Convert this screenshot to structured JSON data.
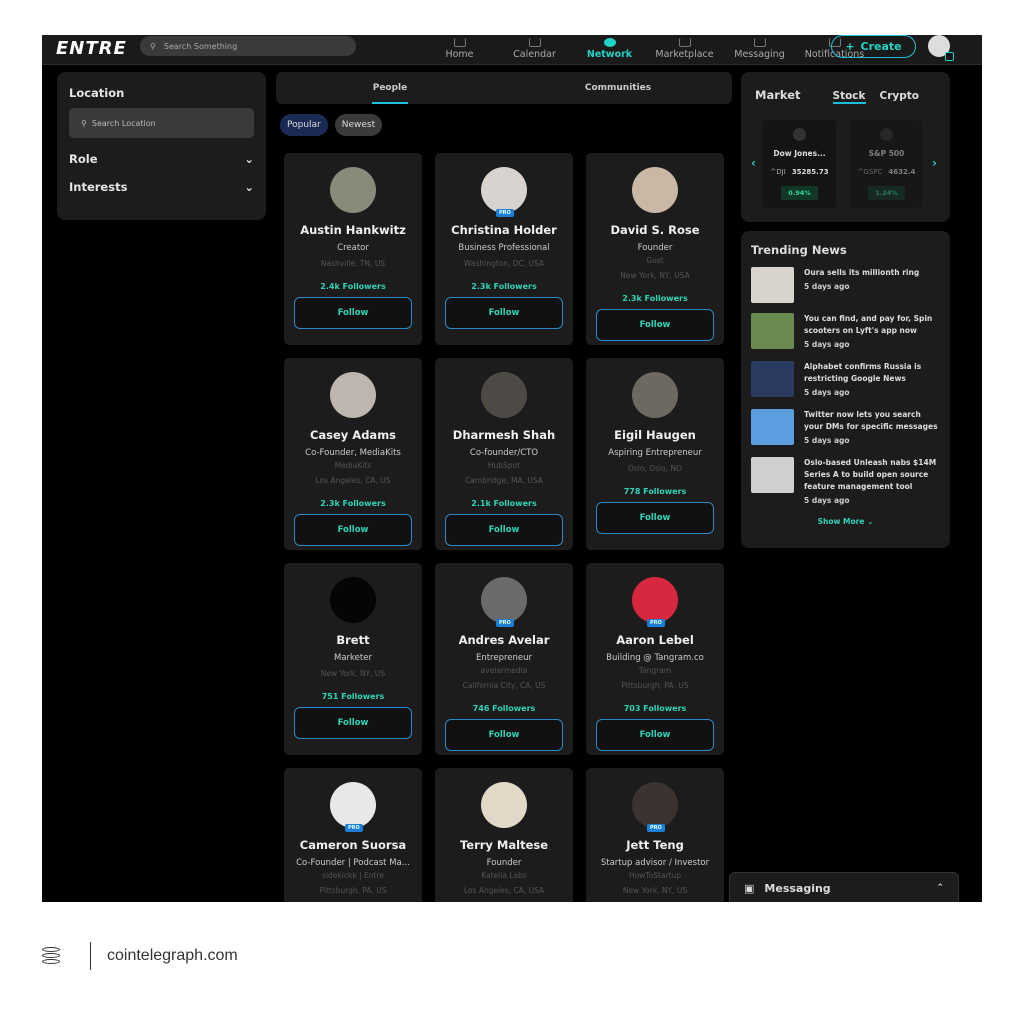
{
  "header": {
    "logo": "ENTRE",
    "search_placeholder": "Search Something",
    "nav": [
      {
        "label": "Home",
        "icon": "home-icon"
      },
      {
        "label": "Calendar",
        "icon": "calendar-icon"
      },
      {
        "label": "Network",
        "icon": "network-icon",
        "active": true
      },
      {
        "label": "Marketplace",
        "icon": "store-icon"
      },
      {
        "label": "Messaging",
        "icon": "mail-icon"
      },
      {
        "label": "Notifications",
        "icon": "bell-icon"
      }
    ],
    "create_label": "Create"
  },
  "filters": {
    "location_title": "Location",
    "location_placeholder": "Search Location",
    "role": "Role",
    "interests": "Interests"
  },
  "tabs": [
    {
      "label": "People",
      "active": true
    },
    {
      "label": "Communities"
    }
  ],
  "pills": [
    "Popular",
    "Newest"
  ],
  "people": [
    {
      "name": "Austin Hankwitz",
      "title": "Creator",
      "location": "Nashville, TN, US",
      "followers": "2.4k Followers",
      "color": "#8a8a7a"
    },
    {
      "name": "Christina Holder",
      "title": "Business Professional",
      "location": "Washington, DC, USA",
      "followers": "2.3k Followers",
      "pro": true,
      "color": "#d9d3cf"
    },
    {
      "name": "David S. Rose",
      "title": "Founder",
      "company": "Gust",
      "location": "New York, NY, USA",
      "followers": "2.3k Followers",
      "color": "#c9b8a5"
    },
    {
      "name": "Casey Adams",
      "title": "Co-Founder, MediaKits",
      "company": "MediaKits",
      "location": "Los Angeles, CA, US",
      "followers": "2.3k Followers",
      "color": "#bdb6ae"
    },
    {
      "name": "Dharmesh Shah",
      "title": "Co-founder/CTO",
      "company": "HubSpot",
      "location": "Cambridge, MA, USA",
      "followers": "2.1k Followers",
      "color": "#4d4a45"
    },
    {
      "name": "Eigil Haugen",
      "title": "Aspiring Entrepreneur",
      "location": "Oslo, Oslo, NO",
      "followers": "778 Followers",
      "color": "#6d6860"
    },
    {
      "name": "Brett",
      "title": "Marketer",
      "location": "New York, NY, US",
      "followers": "751 Followers",
      "color": "#050505"
    },
    {
      "name": "Andres Avelar",
      "title": "Entrepreneur",
      "company": "avelarmedia",
      "location": "California City, CA, US",
      "followers": "746 Followers",
      "pro": true,
      "color": "#6c6a68"
    },
    {
      "name": "Aaron Lebel",
      "title": "Building @ Tangram.co",
      "company": "Tangram",
      "location": "Pittsburgh, PA, US",
      "followers": "703 Followers",
      "pro": true,
      "color": "#d8283f"
    },
    {
      "name": "Cameron Suorsa",
      "title": "Co-Founder | Podcast Ma...",
      "company": "sidekickk | Entre",
      "location": "Pittsburgh, PA, US",
      "pro": true,
      "color": "#e8e8e8"
    },
    {
      "name": "Terry Maltese",
      "title": "Founder",
      "company": "Katella Labs",
      "location": "Los Angeles, CA, USA",
      "color": "#e2d8c8"
    },
    {
      "name": "Jett Teng",
      "title": "Startup advisor / Investor",
      "company": "HowToStartup",
      "location": "New York, NY, US",
      "pro": true,
      "color": "#3a3330"
    }
  ],
  "follow_label": "Follow",
  "pro_label": "PRO",
  "market": {
    "title": "Market",
    "tabs": [
      "Stock",
      "Crypto"
    ],
    "items": [
      {
        "name": "Dow Jones...",
        "symbol": "^DJI",
        "value": "35285.73",
        "change": "0.94%"
      },
      {
        "name": "S&P 500",
        "symbol": "^GSPC",
        "value": "4632.4",
        "change": "1.24%"
      }
    ]
  },
  "news": {
    "title": "Trending News",
    "items": [
      {
        "headline": "Oura sells its millionth ring",
        "time": "5 days ago",
        "color": "#d8d4cc"
      },
      {
        "headline": "You can find, and pay for, Spin scooters on Lyft's app now",
        "time": "5 days ago",
        "color": "#6a8a50"
      },
      {
        "headline": "Alphabet confirms Russia is restricting Google News",
        "time": "5 days ago",
        "color": "#2a3a60"
      },
      {
        "headline": "Twitter now lets you search your DMs for specific messages",
        "time": "5 days ago",
        "color": "#5a9ee0"
      },
      {
        "headline": "Oslo-based Unleash nabs $14M Series A to build open source feature management tool",
        "time": "5 days ago",
        "color": "#cfcfcf"
      }
    ],
    "show_more": "Show More"
  },
  "messaging": {
    "label": "Messaging"
  },
  "footer": {
    "site": "cointelegraph.com"
  },
  "colors": {
    "accent": "#22d3c5",
    "bg": "#000000",
    "panel": "#1c1c1c"
  }
}
